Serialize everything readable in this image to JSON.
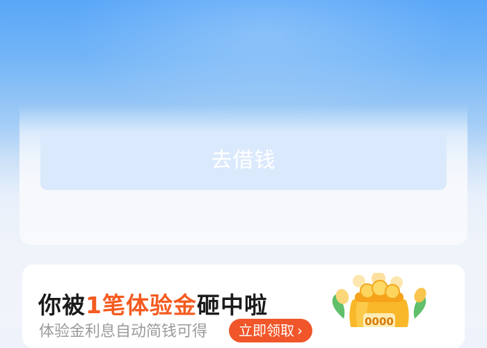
{
  "main": {
    "borrow_button_label": "去借钱"
  },
  "promo": {
    "title_prefix": "你被",
    "title_highlight": "1笔体验金",
    "title_suffix": "砸中啦",
    "subtitle": "体验金利息自动简钱可得",
    "claim_label": "立即领取",
    "claim_arrow": "›",
    "bag_label": "0000"
  },
  "colors": {
    "highlight": "#f45b20",
    "claim_button": "#f0562a",
    "borrow_button": "#dbe9fc"
  }
}
